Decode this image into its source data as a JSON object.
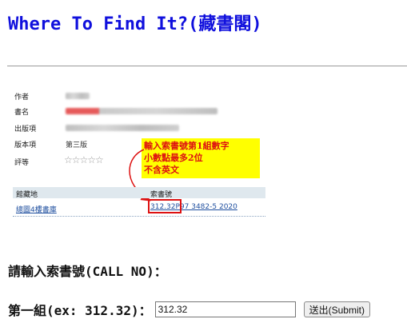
{
  "page": {
    "title": "Where To Find It?(藏書閣)"
  },
  "catalog_image": {
    "labels": [
      "作者",
      "書名",
      "出版項",
      "版本項",
      "評等"
    ],
    "edition": "第三版",
    "rating_stars": "☆☆☆☆☆",
    "note_lines": [
      "輸入索書號第1組數字",
      "小數點最多2位",
      "不含英文"
    ],
    "table_headers": [
      "館藏地",
      "索書號"
    ],
    "location": "總圖4樓書庫",
    "call_number": "312.32P97 3482-5 2020"
  },
  "form": {
    "prompt": "請輸入索書號(CALL NO)：",
    "field_label": "第一組(ex: 312.32)：",
    "field_value": "312.32",
    "submit_label": "送出(Submit)"
  },
  "colors": {
    "title": "#1010dd",
    "note_bg": "#ffff00",
    "note_text": "#dd1111",
    "table_header_bg": "#dfe8ee",
    "link": "#1f4f9f"
  }
}
